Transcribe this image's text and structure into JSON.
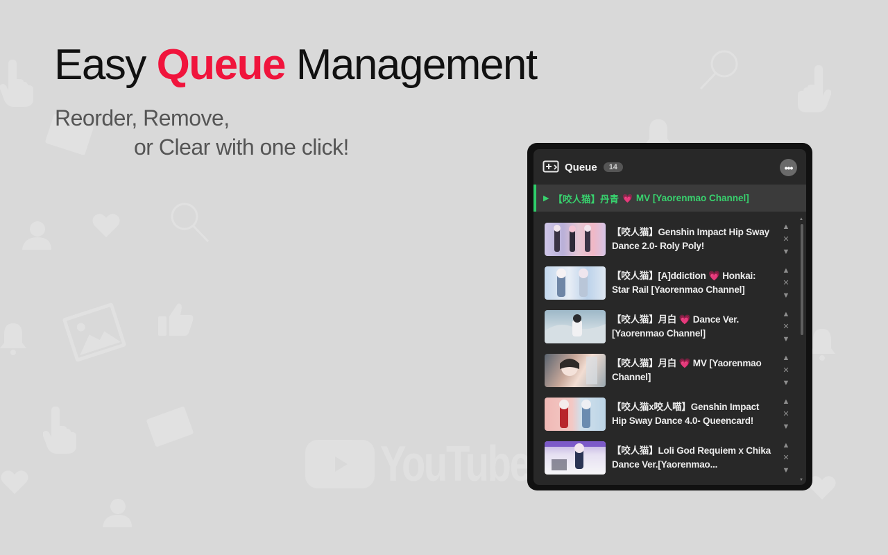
{
  "headline": {
    "prefix": "Easy",
    "accent": "Queue",
    "suffix": "Management"
  },
  "subtitle": {
    "line1": "Reorder, Remove,",
    "line2": "or Clear with one click!"
  },
  "watermark": {
    "text": "YouTube"
  },
  "queue_panel": {
    "icon": "queue-add-icon",
    "title": "Queue",
    "count": "14",
    "more_icon": "more-horizontal-icon",
    "more_label": "•••",
    "now_playing": {
      "icon": "play-icon",
      "play_glyph": "▶",
      "prefix": "【咬人猫】丹青",
      "heart": "💗",
      "suffix": "MV [Yaorenmao Channel]"
    },
    "items": [
      {
        "title": "【咬人猫】Genshin Impact Hip Sway Dance 2.0- Roly Poly!"
      },
      {
        "title": "【咬人猫】[A]ddiction 💗 Honkai: Star Rail [Yaorenmao Channel]"
      },
      {
        "title": "【咬人猫】月白 💗 Dance Ver. [Yaorenmao Channel]"
      },
      {
        "title": "【咬人猫】月白 💗 MV [Yaorenmao Channel]"
      },
      {
        "title": "【咬人猫x咬人喵】Genshin Impact Hip Sway Dance 4.0- Queencard!"
      },
      {
        "title": "【咬人猫】Loli God Requiem x Chika Dance Ver.[Yaorenmao..."
      }
    ],
    "item_controls": {
      "up": "▲",
      "remove": "✕",
      "down": "▼"
    }
  },
  "colors": {
    "accent": "#f0143c",
    "now_playing": "#2fce6a",
    "background": "#d9d9d9",
    "panel": "#282828"
  }
}
